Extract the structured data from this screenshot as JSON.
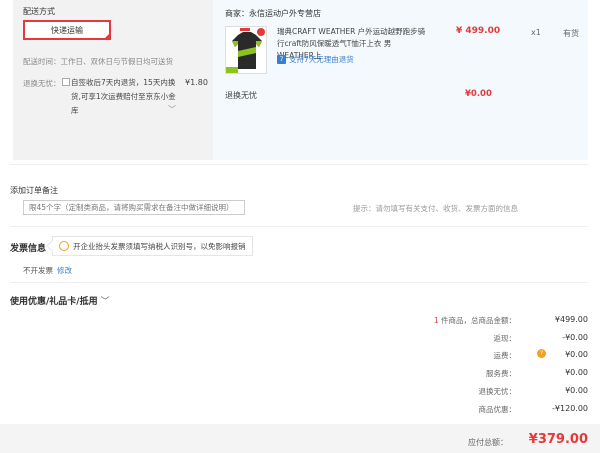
{
  "shipping": {
    "title": "配送方式",
    "method": "快递运输",
    "time": "配送时间：工作日、双休日与节假日均可送货",
    "insure_label": "退换无忧：",
    "insure_text": "自签收后7天内退货，15天内换货,可享1次运费赔付至京东小金库",
    "insure_price": "¥1.80"
  },
  "shop": {
    "name": "商家：永信运动户外专营店",
    "product_title": "瑞典CRAFT WEATHER 户外运动越野跑步骑行craft防风保暖透气T恤汗上衣 男 WEATHER上",
    "return_badge": "支持7天无理由退货",
    "price": "¥ 499.00",
    "qty": "x1",
    "stock": "有货",
    "insure_label": "退换无忧",
    "insure_value": "¥0.00"
  },
  "remark": {
    "label": "添加订单备注",
    "placeholder": "限45个字（定制类商品，请将购买需求在备注中做详细说明）",
    "hint": "提示：请勿填写有关支付、收货、发票方面的信息"
  },
  "invoice": {
    "label": "发票信息",
    "tip": "开企业抬头发票须填写纳税人识别号，以免影响报销",
    "status": "不开发票",
    "modify": "修改"
  },
  "coupon": {
    "label": "使用优惠/礼品卡/抵用",
    "chevron": "﹀"
  },
  "summary": {
    "count_num": "1",
    "count_text": " 件商品，总商品金额：",
    "total_goods": "¥499.00",
    "rebate_label": "返现：",
    "rebate": "-¥0.00",
    "shipping_label": "运费：",
    "shipping": "¥0.00",
    "service_label": "服务费：",
    "service": "¥0.00",
    "insure_label": "退换无忧：",
    "insure": "¥0.00",
    "discount_label": "商品优惠：",
    "discount": "-¥120.00",
    "payable_label": "应付总额：",
    "payable": "¥379.00"
  },
  "colors": {
    "accent": "#e4393c",
    "link": "#3a7fcf",
    "panel_gray": "#f2f2f2",
    "panel_blue": "#f3f9fd"
  }
}
